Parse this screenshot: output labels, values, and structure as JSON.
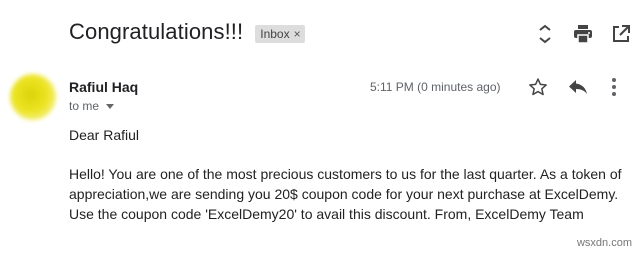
{
  "email": {
    "subject": "Congratulations!!!",
    "label": "Inbox",
    "label_remove": "×",
    "sender_name": "Rafiul Haq",
    "recipient": "to me",
    "timestamp": "5:11 PM (0 minutes ago)",
    "greeting": "Dear Rafiul",
    "body": "Hello! You are one of the most precious customers to us for the last quarter. As a token of appreciation,we are sending you 20$ coupon code for your next purchase at ExcelDemy. Use the coupon code 'ExcelDemy20' to avail this discount. From, ExcelDemy Team"
  },
  "toolbar": {
    "icons": [
      "expand-collapse-icon",
      "print-icon",
      "open-new-window-icon"
    ]
  },
  "actions": {
    "icons": [
      "star-icon",
      "reply-icon",
      "more-vert-icon"
    ]
  },
  "watermark": "wsxdn.com",
  "colors": {
    "text_primary": "#202124",
    "text_secondary": "#5f6368",
    "chip_bg": "#dddddd",
    "avatar": "#e3dc14"
  }
}
